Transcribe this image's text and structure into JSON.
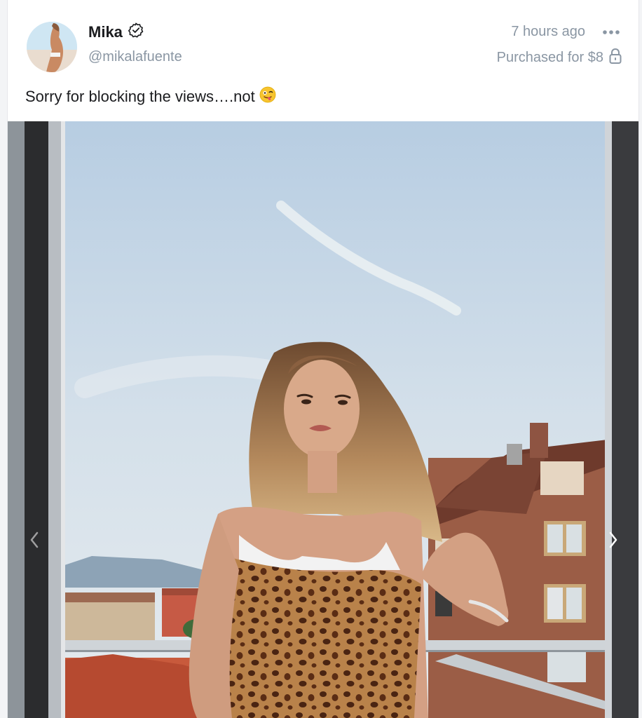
{
  "post": {
    "author": {
      "name": "Mika",
      "handle": "@mikalafuente",
      "verified": true
    },
    "time_ago": "7 hours ago",
    "purchase_text": "Purchased for $8",
    "caption": "Sorry for blocking the views….not",
    "caption_emoji": "😜"
  },
  "icons": {
    "verified": "verified-badge-icon",
    "more": "more-options-icon",
    "lock": "lock-icon",
    "prev": "chevron-left-icon",
    "next": "chevron-right-icon"
  },
  "colors": {
    "text_primary": "#1b1c1f",
    "text_secondary": "#8a96a3",
    "card_background": "#ffffff"
  }
}
